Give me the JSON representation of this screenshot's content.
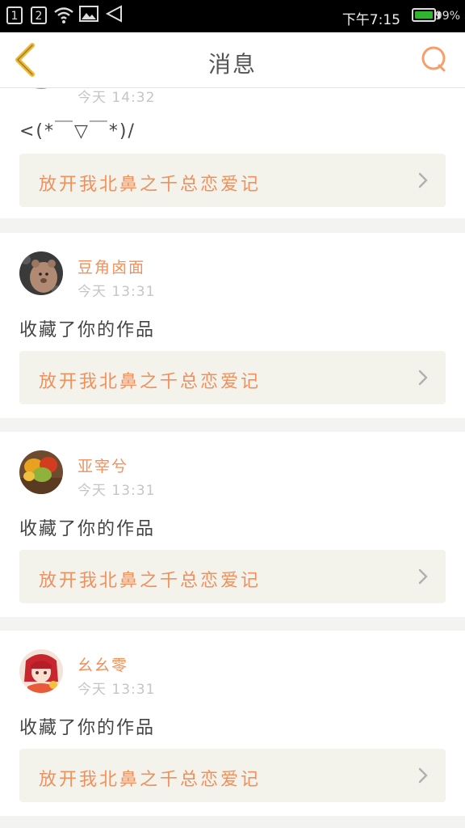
{
  "status_bar": {
    "sim1": "1",
    "sim2": "2",
    "time": "下午7:15",
    "battery": "99%",
    "battery_color": "#2fb52f"
  },
  "header": {
    "title": "消息",
    "back_icon": "chevron-left-icon",
    "search_icon": "search-icon",
    "accent": "#f5a623"
  },
  "messages": [
    {
      "name": "",
      "time": "今天 14:32",
      "text": "<(*￣▽￣*)/",
      "work_title": "放开我北鼻之千总恋爱记"
    },
    {
      "name": "豆角卤面",
      "time": "今天 13:31",
      "text": "收藏了你的作品",
      "work_title": "放开我北鼻之千总恋爱记"
    },
    {
      "name": "亚宰兮",
      "time": "今天 13:31",
      "text": "收藏了你的作品",
      "work_title": "放开我北鼻之千总恋爱记"
    },
    {
      "name": "幺幺零",
      "time": "今天 13:31",
      "text": "收藏了你的作品",
      "work_title": "放开我北鼻之千总恋爱记"
    }
  ],
  "colors": {
    "accent_orange": "#f0905c",
    "card_bg": "#ffffff",
    "work_bg": "#f3f3ec"
  }
}
